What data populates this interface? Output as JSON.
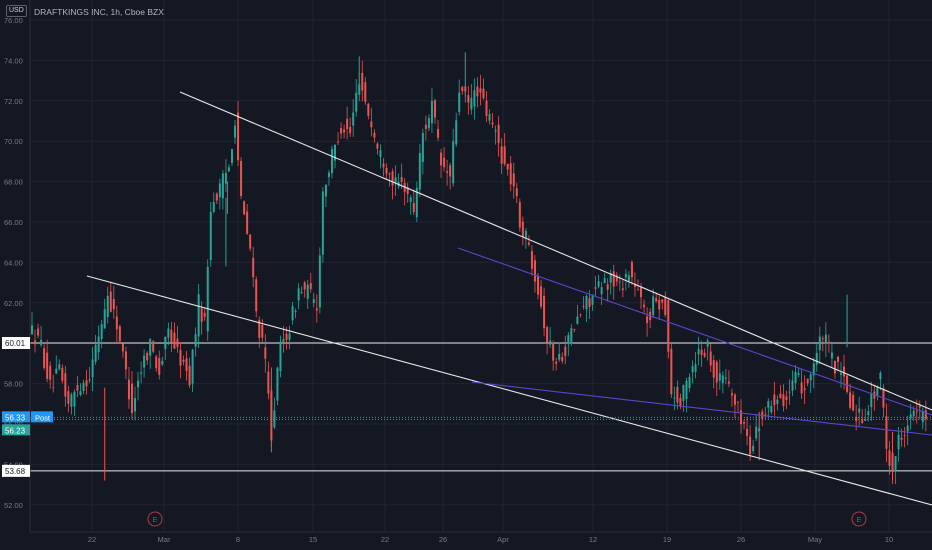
{
  "header": {
    "currency": "USD",
    "title": "DRAFTKINGS INC, 1h, Cboe BZX"
  },
  "colors": {
    "background": "#141823",
    "up": "#26a69a",
    "down": "#ef5350",
    "grid": "#1f2431",
    "axis_text": "#787b86",
    "trendline": "#e8e8e8",
    "channel": "#5b45c9",
    "price_tag": "#2196f3",
    "post_line": "#2a8fd6",
    "close_tag": "#26a69a",
    "earnings": "#b2384a"
  },
  "chart_data": {
    "type": "candlestick",
    "title": "DRAFTKINGS INC, 1h, Cboe BZX",
    "ylim": [
      51,
      76
    ],
    "y_ticks": [
      "76.00",
      "74.00",
      "72.00",
      "70.00",
      "68.00",
      "66.00",
      "64.00",
      "62.00",
      "60.00",
      "58.00",
      "56.00",
      "54.00",
      "52.00"
    ],
    "x_labels": [
      "22",
      "Mar",
      "8",
      "15",
      "22",
      "26",
      "Apr",
      "12",
      "19",
      "26",
      "May",
      "10"
    ],
    "horizontal_levels": [
      {
        "label": "60.01",
        "value": 60.01
      },
      {
        "label": "53.68",
        "value": 53.68
      }
    ],
    "price_tags": [
      {
        "label": "56.33",
        "value": 56.33,
        "note": "Post"
      },
      {
        "label": "56.23",
        "value": 56.23
      }
    ],
    "earnings_markers": [
      "E",
      "E"
    ],
    "price_path": [
      {
        "t": 0,
        "p": 60.8
      },
      {
        "t": 4,
        "p": 59.9
      },
      {
        "t": 7,
        "p": 57.8
      },
      {
        "t": 10,
        "p": 58.6
      },
      {
        "t": 13,
        "p": 57.0
      },
      {
        "t": 16,
        "p": 57.8
      },
      {
        "t": 20,
        "p": 58.4
      },
      {
        "t": 23,
        "p": 60.4
      },
      {
        "t": 26,
        "p": 62.4
      },
      {
        "t": 29,
        "p": 61.0
      },
      {
        "t": 32,
        "p": 58.5
      },
      {
        "t": 34,
        "p": 56.8
      },
      {
        "t": 37,
        "p": 58.8
      },
      {
        "t": 40,
        "p": 60.0
      },
      {
        "t": 43,
        "p": 58.6
      },
      {
        "t": 46,
        "p": 60.6
      },
      {
        "t": 50,
        "p": 59.2
      },
      {
        "t": 53,
        "p": 58.2
      },
      {
        "t": 56,
        "p": 62.0
      },
      {
        "t": 58,
        "p": 61.0
      },
      {
        "t": 60,
        "p": 66.8
      },
      {
        "t": 63,
        "p": 67.6
      },
      {
        "t": 66,
        "p": 68.8
      },
      {
        "t": 68,
        "p": 71.2
      },
      {
        "t": 70,
        "p": 67.0
      },
      {
        "t": 73,
        "p": 64.6
      },
      {
        "t": 75,
        "p": 61.5
      },
      {
        "t": 78,
        "p": 59.0
      },
      {
        "t": 80,
        "p": 55.6
      },
      {
        "t": 83,
        "p": 59.8
      },
      {
        "t": 86,
        "p": 60.8
      },
      {
        "t": 89,
        "p": 62.6
      },
      {
        "t": 92,
        "p": 62.6
      },
      {
        "t": 95,
        "p": 61.8
      },
      {
        "t": 97,
        "p": 67.5
      },
      {
        "t": 100,
        "p": 69.2
      },
      {
        "t": 103,
        "p": 70.8
      },
      {
        "t": 106,
        "p": 70.4
      },
      {
        "t": 109,
        "p": 73.2
      },
      {
        "t": 112,
        "p": 71.4
      },
      {
        "t": 115,
        "p": 69.6
      },
      {
        "t": 118,
        "p": 68.8
      },
      {
        "t": 121,
        "p": 67.8
      },
      {
        "t": 124,
        "p": 67.8
      },
      {
        "t": 127,
        "p": 66.6
      },
      {
        "t": 130,
        "p": 70.4
      },
      {
        "t": 133,
        "p": 71.8
      },
      {
        "t": 136,
        "p": 68.8
      },
      {
        "t": 139,
        "p": 68.2
      },
      {
        "t": 142,
        "p": 72.6
      },
      {
        "t": 145,
        "p": 71.8
      },
      {
        "t": 148,
        "p": 72.6
      },
      {
        "t": 151,
        "p": 71.4
      },
      {
        "t": 154,
        "p": 70.4
      },
      {
        "t": 157,
        "p": 68.8
      },
      {
        "t": 160,
        "p": 67.8
      },
      {
        "t": 162,
        "p": 66.0
      },
      {
        "t": 165,
        "p": 64.8
      },
      {
        "t": 168,
        "p": 62.8
      },
      {
        "t": 171,
        "p": 60.2
      },
      {
        "t": 174,
        "p": 59.0
      },
      {
        "t": 177,
        "p": 59.8
      },
      {
        "t": 180,
        "p": 60.8
      },
      {
        "t": 183,
        "p": 61.8
      },
      {
        "t": 186,
        "p": 62.4
      },
      {
        "t": 189,
        "p": 62.8
      },
      {
        "t": 192,
        "p": 63.2
      },
      {
        "t": 195,
        "p": 62.8
      },
      {
        "t": 198,
        "p": 63.6
      },
      {
        "t": 201,
        "p": 62.4
      },
      {
        "t": 204,
        "p": 61.2
      },
      {
        "t": 207,
        "p": 62.2
      },
      {
        "t": 210,
        "p": 61.8
      },
      {
        "t": 212,
        "p": 57.6
      },
      {
        "t": 215,
        "p": 57.0
      },
      {
        "t": 218,
        "p": 58.6
      },
      {
        "t": 221,
        "p": 59.6
      },
      {
        "t": 224,
        "p": 59.8
      },
      {
        "t": 227,
        "p": 58.2
      },
      {
        "t": 230,
        "p": 58.4
      },
      {
        "t": 233,
        "p": 57.0
      },
      {
        "t": 236,
        "p": 56.0
      },
      {
        "t": 238,
        "p": 54.6
      },
      {
        "t": 241,
        "p": 56.2
      },
      {
        "t": 244,
        "p": 56.8
      },
      {
        "t": 247,
        "p": 57.6
      },
      {
        "t": 250,
        "p": 57.2
      },
      {
        "t": 253,
        "p": 58.2
      },
      {
        "t": 256,
        "p": 57.8
      },
      {
        "t": 259,
        "p": 59.0
      },
      {
        "t": 262,
        "p": 60.4
      },
      {
        "t": 265,
        "p": 59.2
      },
      {
        "t": 268,
        "p": 58.4
      },
      {
        "t": 270,
        "p": 57.6
      },
      {
        "t": 272,
        "p": 56.6
      },
      {
        "t": 275,
        "p": 56.4
      },
      {
        "t": 278,
        "p": 57.2
      },
      {
        "t": 281,
        "p": 58.2
      },
      {
        "t": 283,
        "p": 54.8
      },
      {
        "t": 285,
        "p": 53.8
      },
      {
        "t": 287,
        "p": 55.2
      },
      {
        "t": 290,
        "p": 56.2
      },
      {
        "t": 293,
        "p": 56.6
      },
      {
        "t": 296,
        "p": 56.23
      }
    ]
  }
}
